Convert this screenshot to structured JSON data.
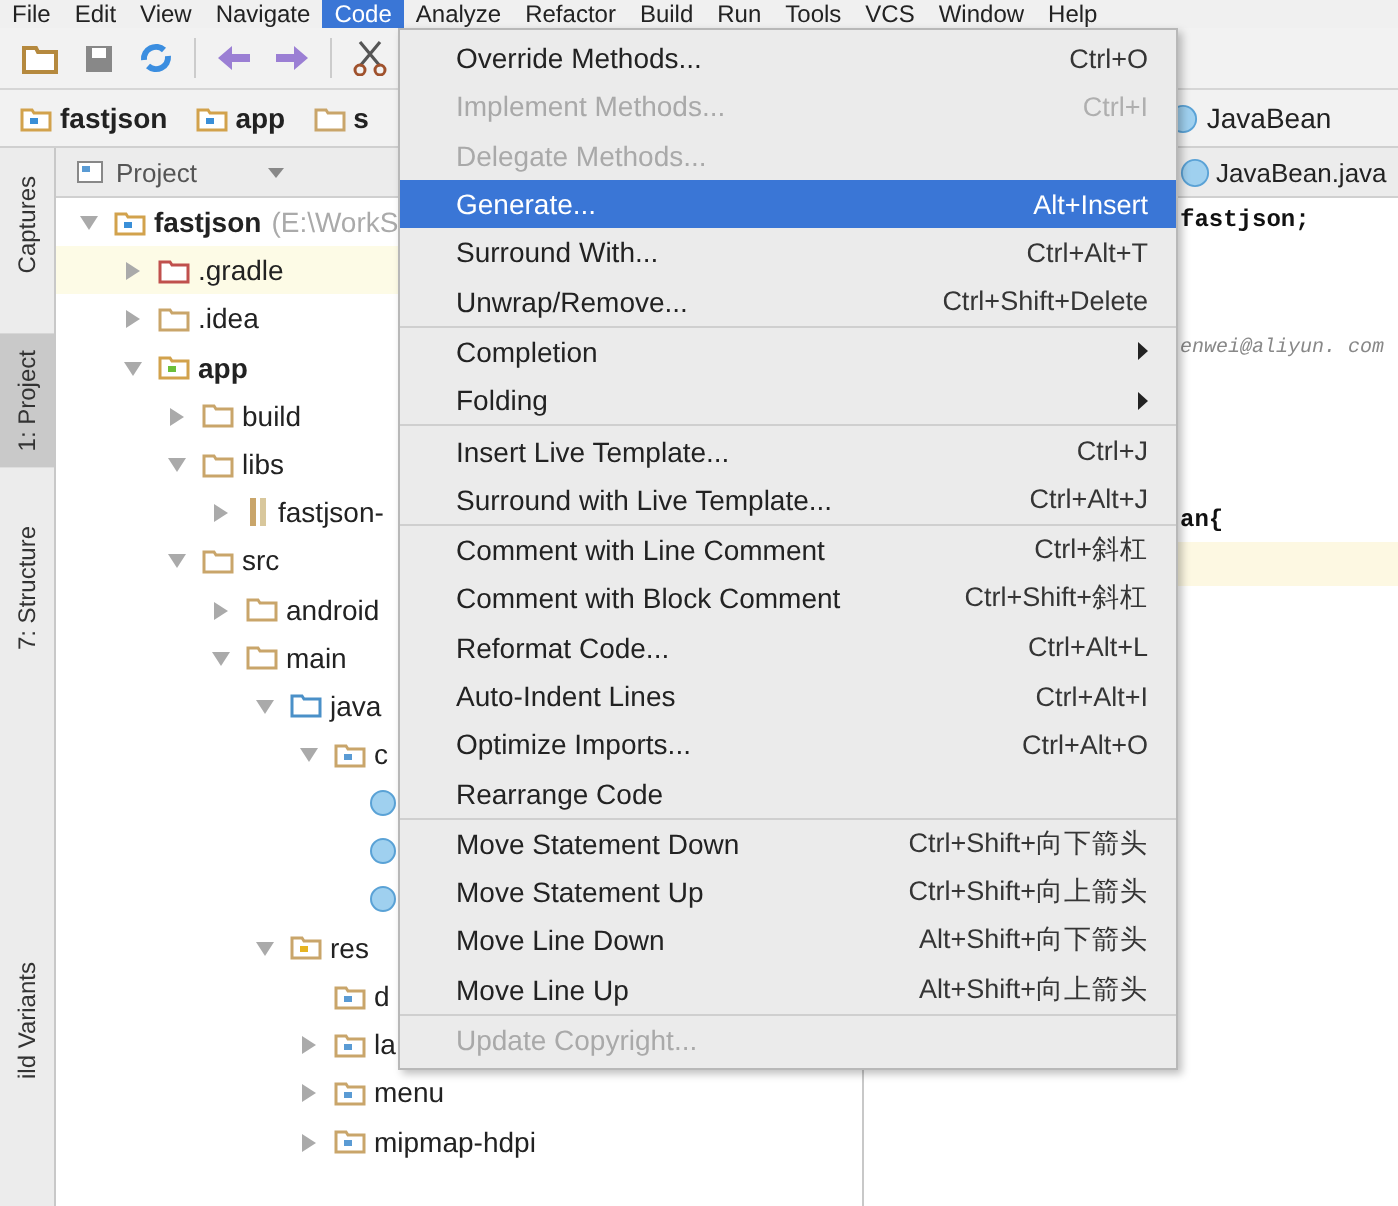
{
  "menubar": [
    {
      "label": "File",
      "selected": false
    },
    {
      "label": "Edit",
      "selected": false
    },
    {
      "label": "View",
      "selected": false
    },
    {
      "label": "Navigate",
      "selected": false
    },
    {
      "label": "Code",
      "selected": true
    },
    {
      "label": "Analyze",
      "selected": false
    },
    {
      "label": "Refactor",
      "selected": false
    },
    {
      "label": "Build",
      "selected": false
    },
    {
      "label": "Run",
      "selected": false
    },
    {
      "label": "Tools",
      "selected": false
    },
    {
      "label": "VCS",
      "selected": false
    },
    {
      "label": "Window",
      "selected": false
    },
    {
      "label": "Help",
      "selected": false
    }
  ],
  "breadcrumbs": [
    {
      "label": "fastjson",
      "kind": "module"
    },
    {
      "label": "app",
      "kind": "module"
    },
    {
      "label": "s",
      "kind": "folder"
    }
  ],
  "editor_breadcrumb": {
    "label": "JavaBean"
  },
  "tool_windows": [
    {
      "label": "Captures",
      "selected": false
    },
    {
      "label": "1: Project",
      "selected": true
    },
    {
      "label": "7: Structure",
      "selected": false
    },
    {
      "label": "ild Variants",
      "selected": false
    }
  ],
  "project_panel": {
    "title": "Project"
  },
  "tree": [
    {
      "label": "fastjson",
      "detail": "(E:\\WorkS",
      "kind": "module",
      "bold": true,
      "expanded": true,
      "highlighted": false,
      "children": [
        {
          "label": ".gradle",
          "kind": "folder-red",
          "expanded": false,
          "highlighted": true
        },
        {
          "label": ".idea",
          "kind": "folder",
          "expanded": false,
          "highlighted": false
        },
        {
          "label": "app",
          "kind": "app-module",
          "bold": true,
          "expanded": true,
          "highlighted": false,
          "children": [
            {
              "label": "build",
              "kind": "folder",
              "expanded": false,
              "highlighted": false
            },
            {
              "label": "libs",
              "kind": "folder",
              "expanded": true,
              "highlighted": false,
              "children": [
                {
                  "label": "fastjson-",
                  "kind": "jar",
                  "expanded": false,
                  "highlighted": false
                }
              ]
            },
            {
              "label": "src",
              "kind": "folder",
              "expanded": true,
              "highlighted": false,
              "children": [
                {
                  "label": "android",
                  "kind": "folder",
                  "expanded": false,
                  "highlighted": false
                },
                {
                  "label": "main",
                  "kind": "folder",
                  "expanded": true,
                  "highlighted": false,
                  "children": [
                    {
                      "label": "java",
                      "kind": "source-folder",
                      "expanded": true,
                      "highlighted": false,
                      "children": [
                        {
                          "label": "c",
                          "kind": "package",
                          "expanded": true,
                          "highlighted": false,
                          "children": [
                            {
                              "kind": "class",
                              "highlighted": false
                            },
                            {
                              "kind": "class",
                              "highlighted": false
                            },
                            {
                              "kind": "class",
                              "highlighted": false
                            }
                          ]
                        }
                      ]
                    },
                    {
                      "label": "res",
                      "kind": "res-folder",
                      "expanded": true,
                      "highlighted": false,
                      "children": [
                        {
                          "label": "d",
                          "kind": "package",
                          "highlighted": false
                        },
                        {
                          "label": "la",
                          "kind": "package",
                          "expanded": false,
                          "highlighted": false
                        },
                        {
                          "label": "menu",
                          "kind": "package",
                          "expanded": false,
                          "highlighted": false
                        },
                        {
                          "label": "mipmap-hdpi",
                          "kind": "package",
                          "expanded": false,
                          "highlighted": false
                        }
                      ]
                    }
                  ]
                }
              ]
            }
          ]
        }
      ]
    }
  ],
  "editor_tab": {
    "label": "JavaBean.java"
  },
  "code_lines": [
    {
      "text": "fastjson;",
      "kind": "code"
    },
    {
      "kind": "blank"
    },
    {
      "kind": "blank"
    },
    {
      "text": "enwei@aliyun. com",
      "kind": "comment"
    },
    {
      "kind": "blank"
    },
    {
      "kind": "blank"
    },
    {
      "kind": "blank"
    },
    {
      "text": "an{",
      "kind": "code"
    },
    {
      "kind": "current"
    }
  ],
  "code_menu": {
    "groups": [
      [
        {
          "label": "Override Methods...",
          "shortcut": "Ctrl+O",
          "disabled": false,
          "selected": false,
          "kind": "action"
        },
        {
          "label": "Implement Methods...",
          "shortcut": "Ctrl+I",
          "disabled": true,
          "selected": false,
          "kind": "action"
        },
        {
          "label": "Delegate Methods...",
          "disabled": true,
          "selected": false,
          "kind": "action"
        },
        {
          "label": "Generate...",
          "shortcut": "Alt+Insert",
          "disabled": false,
          "selected": true,
          "kind": "action"
        },
        {
          "label": "Surround With...",
          "shortcut": "Ctrl+Alt+T",
          "disabled": false,
          "selected": false,
          "kind": "action"
        },
        {
          "label": "Unwrap/Remove...",
          "shortcut": "Ctrl+Shift+Delete",
          "disabled": false,
          "selected": false,
          "kind": "action"
        }
      ],
      [
        {
          "label": "Completion",
          "disabled": false,
          "selected": false,
          "kind": "submenu"
        },
        {
          "label": "Folding",
          "disabled": false,
          "selected": false,
          "kind": "submenu"
        }
      ],
      [
        {
          "label": "Insert Live Template...",
          "shortcut": "Ctrl+J",
          "disabled": false,
          "selected": false,
          "kind": "action"
        },
        {
          "label": "Surround with Live Template...",
          "shortcut": "Ctrl+Alt+J",
          "disabled": false,
          "selected": false,
          "kind": "action"
        }
      ],
      [
        {
          "label": "Comment with Line Comment",
          "shortcut": "Ctrl+斜杠",
          "disabled": false,
          "selected": false,
          "kind": "action"
        },
        {
          "label": "Comment with Block Comment",
          "shortcut": "Ctrl+Shift+斜杠",
          "disabled": false,
          "selected": false,
          "kind": "action"
        },
        {
          "label": "Reformat Code...",
          "shortcut": "Ctrl+Alt+L",
          "disabled": false,
          "selected": false,
          "kind": "action"
        },
        {
          "label": "Auto-Indent Lines",
          "shortcut": "Ctrl+Alt+I",
          "disabled": false,
          "selected": false,
          "kind": "action"
        },
        {
          "label": "Optimize Imports...",
          "shortcut": "Ctrl+Alt+O",
          "disabled": false,
          "selected": false,
          "kind": "action"
        },
        {
          "label": "Rearrange Code",
          "disabled": false,
          "selected": false,
          "kind": "action"
        }
      ],
      [
        {
          "label": "Move Statement Down",
          "shortcut": "Ctrl+Shift+向下箭头",
          "disabled": false,
          "selected": false,
          "kind": "action"
        },
        {
          "label": "Move Statement Up",
          "shortcut": "Ctrl+Shift+向上箭头",
          "disabled": false,
          "selected": false,
          "kind": "action"
        },
        {
          "label": "Move Line Down",
          "shortcut": "Alt+Shift+向下箭头",
          "disabled": false,
          "selected": false,
          "kind": "action"
        },
        {
          "label": "Move Line Up",
          "shortcut": "Alt+Shift+向上箭头",
          "disabled": false,
          "selected": false,
          "kind": "action"
        }
      ],
      [
        {
          "label": "Update Copyright...",
          "disabled": true,
          "selected": false,
          "kind": "action"
        }
      ]
    ]
  }
}
